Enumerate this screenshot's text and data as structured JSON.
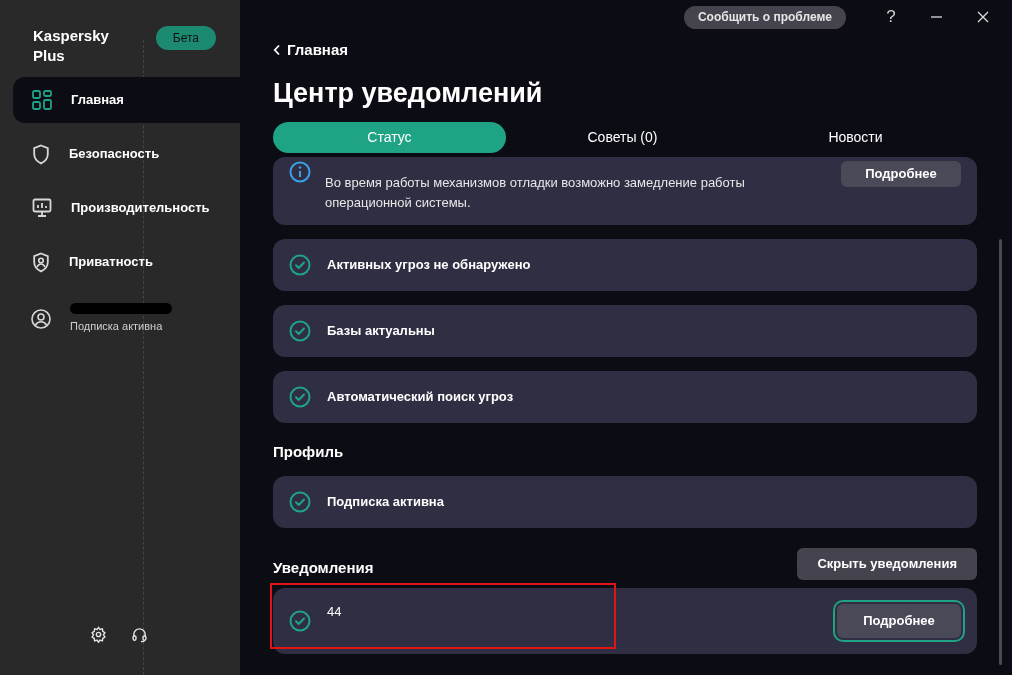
{
  "sidebar": {
    "app_name": "Kaspersky Plus",
    "badge": "Бета",
    "items": [
      {
        "label": "Главная",
        "selected": true
      },
      {
        "label": "Безопасность",
        "selected": false
      },
      {
        "label": "Производительность",
        "selected": false
      },
      {
        "label": "Приватность",
        "selected": false
      }
    ],
    "account": {
      "status": "Подписка активна"
    }
  },
  "header": {
    "report_button": "Сообщить о проблеме",
    "help": "?",
    "back_link": "Главная",
    "title": "Центр уведомлений"
  },
  "tabs": [
    {
      "label": "Статус",
      "selected": true
    },
    {
      "label": "Советы (0)",
      "selected": false
    },
    {
      "label": "Новости",
      "selected": false
    }
  ],
  "top_card": {
    "text": "Во время работы механизмов отладки возможно замедление работы операционной системы.",
    "button": "Подробнее"
  },
  "status_items": [
    {
      "label": "Активных угроз не обнаружено"
    },
    {
      "label": "Базы актуальны"
    },
    {
      "label": "Автоматический поиск угроз"
    }
  ],
  "profile": {
    "heading": "Профиль",
    "items": [
      {
        "label": "Подписка активна"
      }
    ]
  },
  "notifications": {
    "heading": "Уведомления",
    "hide_button": "Скрыть уведомления",
    "items": [
      {
        "label": "44",
        "button": "Подробнее",
        "highlighted": true
      }
    ]
  }
}
